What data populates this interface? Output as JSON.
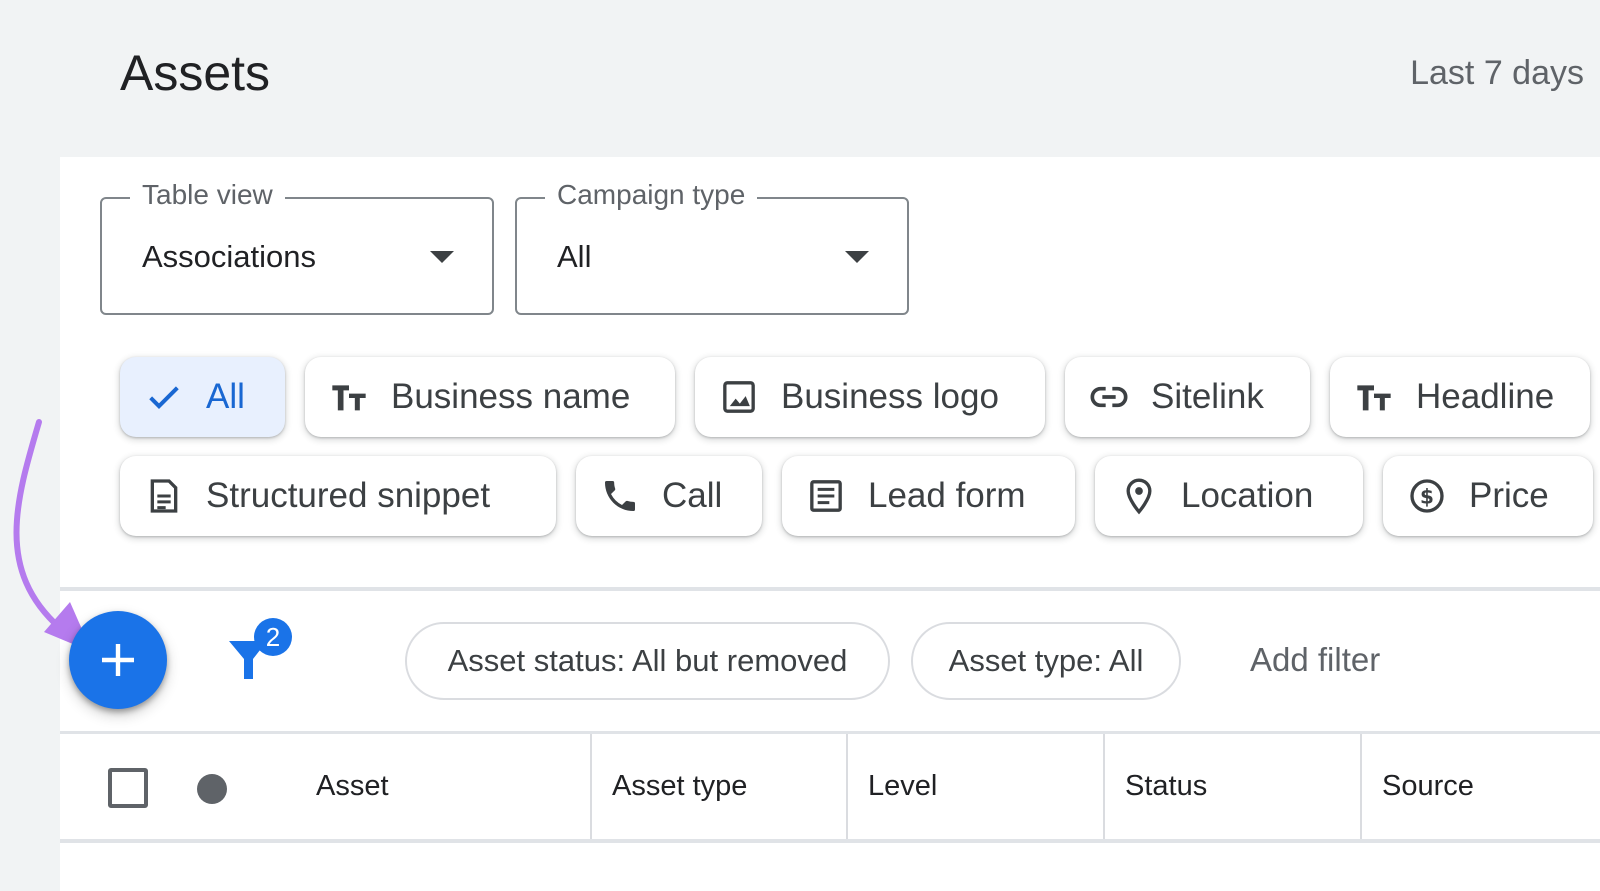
{
  "header": {
    "title": "Assets",
    "date_range": "Last 7 days"
  },
  "selects": {
    "table_view": {
      "label": "Table view",
      "value": "Associations"
    },
    "campaign_type": {
      "label": "Campaign type",
      "value": "All"
    }
  },
  "asset_chips": {
    "row1": [
      {
        "label": "All",
        "icon": "check-icon",
        "selected": true
      },
      {
        "label": "Business name",
        "icon": "text-fields-icon"
      },
      {
        "label": "Business logo",
        "icon": "image-icon"
      },
      {
        "label": "Sitelink",
        "icon": "link-icon"
      },
      {
        "label": "Headline",
        "icon": "text-fields-icon"
      }
    ],
    "row2": [
      {
        "label": "Structured snippet",
        "icon": "document-icon"
      },
      {
        "label": "Call",
        "icon": "phone-icon"
      },
      {
        "label": "Lead form",
        "icon": "list-form-icon"
      },
      {
        "label": "Location",
        "icon": "location-pin-icon"
      },
      {
        "label": "Price",
        "icon": "dollar-circle-icon"
      }
    ]
  },
  "toolbar": {
    "add_button_icon": "plus-icon",
    "filter_icon": "filter-icon",
    "filter_badge": "2",
    "filters": [
      "Asset status: All but removed",
      "Asset type: All"
    ],
    "add_filter": "Add filter"
  },
  "table": {
    "columns": [
      "Asset",
      "Asset type",
      "Level",
      "Status",
      "Source"
    ]
  },
  "colors": {
    "accent": "#1a73e8",
    "selected_chip_bg": "#e8f0fe",
    "annotation_arrow": "#b57bee",
    "page_bg": "#f1f3f4"
  }
}
